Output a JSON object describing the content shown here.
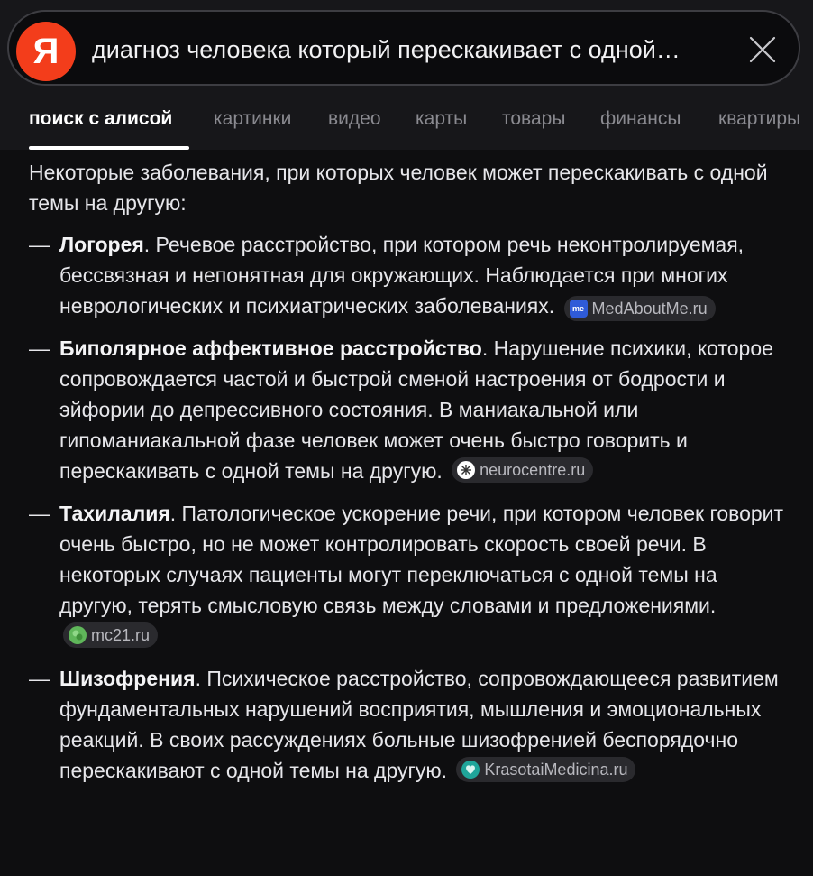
{
  "search": {
    "query": "диагноз человека который перескакивает с одной…",
    "logo_letter": "Я"
  },
  "tabs": [
    {
      "label": "поиск с алисой",
      "active": true
    },
    {
      "label": "картинки"
    },
    {
      "label": "видео"
    },
    {
      "label": "карты"
    },
    {
      "label": "товары"
    },
    {
      "label": "финансы"
    },
    {
      "label": "квартиры"
    }
  ],
  "answer": {
    "intro": "Некоторые заболевания, при которых человек может перескакивать с одной темы на другую:",
    "items": [
      {
        "term": "Логорея",
        "text": ". Речевое расстройство, при котором речь неконтролируемая, бессвязная и непонятная для окружающих. Наблюдается при многих неврологических и психиатрических заболеваниях.",
        "source": "MedAboutMe.ru",
        "source_icon": "medaboutme-icon"
      },
      {
        "term": "Биполярное аффективное расстройство",
        "text": ". Нарушение психики, которое сопровождается частой и быстрой сменой настроения от бодрости и эйфории до депрессивного состояния. В маниакальной или гипоманиакальной фазе человек может очень быстро говорить и перескакивать с одной темы на другую.",
        "source": "neurocentre.ru",
        "source_icon": "neurocentre-icon"
      },
      {
        "term": "Тахилалия",
        "text": ". Патологическое ускорение речи, при котором человек говорит очень быстро, но не может контролировать скорость своей речи. В некоторых случаях пациенты могут переключаться с одной темы на другую, терять смысловую связь между словами и предложениями.",
        "source": "mc21.ru",
        "source_icon": "mc21-icon"
      },
      {
        "term": "Шизофрения",
        "text": ". Психическое расстройство, сопровождающееся развитием фундаментальных нарушений восприятия, мышления и эмоциональных реакций. В своих рассуждениях больные шизофренией беспорядочно перескакивают с одной темы на другую.",
        "source": "KrasotaiMedicina.ru",
        "source_icon": "krasotaimedicina-icon"
      }
    ]
  },
  "colors": {
    "background": "#0e0e10",
    "header": "#17171a",
    "logo": "#f33d1b",
    "text": "#e6e6ea",
    "muted": "#8a8a90"
  }
}
